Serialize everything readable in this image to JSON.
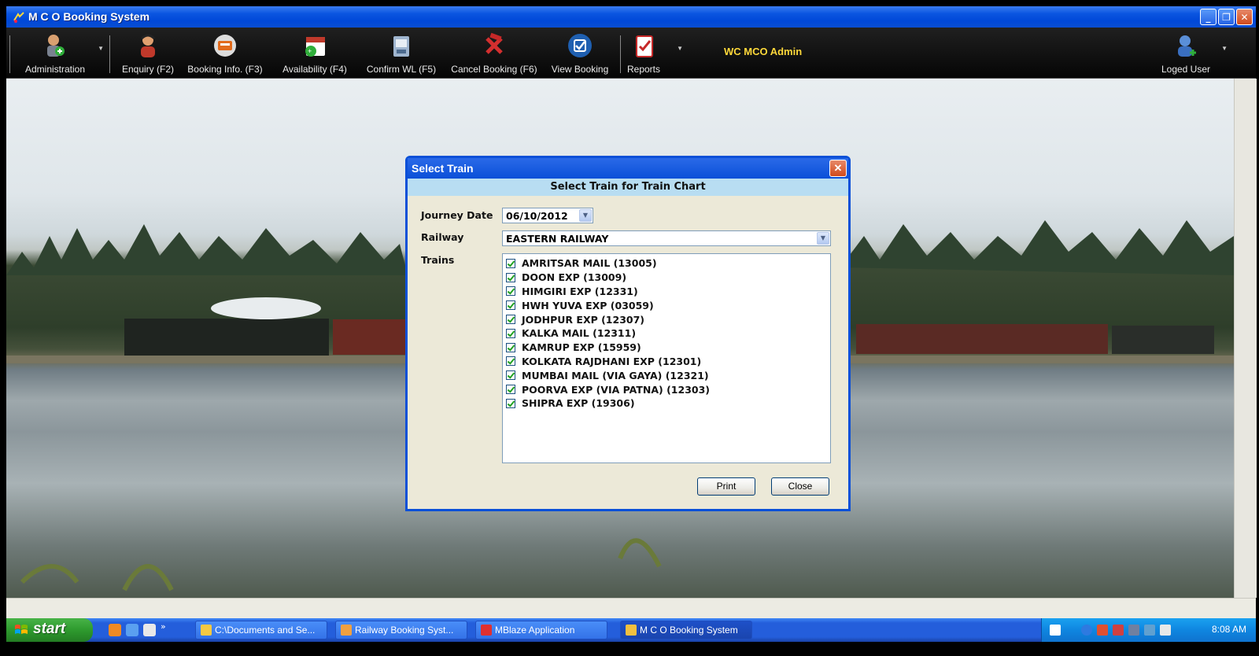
{
  "window": {
    "title": "M C O Booking System"
  },
  "toolbar": {
    "items": [
      {
        "label": "Administration",
        "icon": "admin-user-icon"
      },
      {
        "label": "Enquiry (F2)",
        "icon": "enquiry-person-icon"
      },
      {
        "label": "Booking Info. (F3)",
        "icon": "booking-info-icon"
      },
      {
        "label": "Availability (F4)",
        "icon": "calendar-icon"
      },
      {
        "label": "Confirm WL (F5)",
        "icon": "confirm-wl-icon"
      },
      {
        "label": "Cancel Booking (F6)",
        "icon": "cancel-booking-icon"
      },
      {
        "label": "View Booking",
        "icon": "checkmark-icon"
      },
      {
        "label": "Reports",
        "icon": "clipboard-icon"
      }
    ],
    "admin_label": "WC MCO Admin",
    "user_label": "Loged User"
  },
  "dialog": {
    "title": "Select Train",
    "header": "Select Train for Train Chart",
    "journey_date_label": "Journey Date",
    "journey_date": "06/10/2012",
    "railway_label": "Railway",
    "railway": "EASTERN RAILWAY",
    "trains_label": "Trains",
    "trains": [
      "AMRITSAR MAIL (13005)",
      "DOON EXP (13009)",
      "HIMGIRI EXP (12331)",
      "HWH YUVA EXP (03059)",
      "JODHPUR EXP (12307)",
      "KALKA MAIL (12311)",
      "KAMRUP EXP (15959)",
      "KOLKATA RAJDHANI EXP (12301)",
      "MUMBAI MAIL (VIA GAYA) (12321)",
      "POORVA EXP (VIA PATNA) (12303)",
      "SHIPRA EXP (19306)"
    ],
    "print_label": "Print",
    "close_label": "Close"
  },
  "taskbar": {
    "start_label": "start",
    "tasks": [
      "C:\\Documents and Se...",
      "Railway Booking Syst...",
      "MBlaze Application",
      "M C O Booking System"
    ],
    "clock": "8:08 AM"
  },
  "colors": {
    "title_blue": "#0a50d8",
    "toolbar_bg": "#0b0b0b",
    "admin_yellow": "#ffd93a",
    "dialog_header": "#b8ddf2"
  }
}
